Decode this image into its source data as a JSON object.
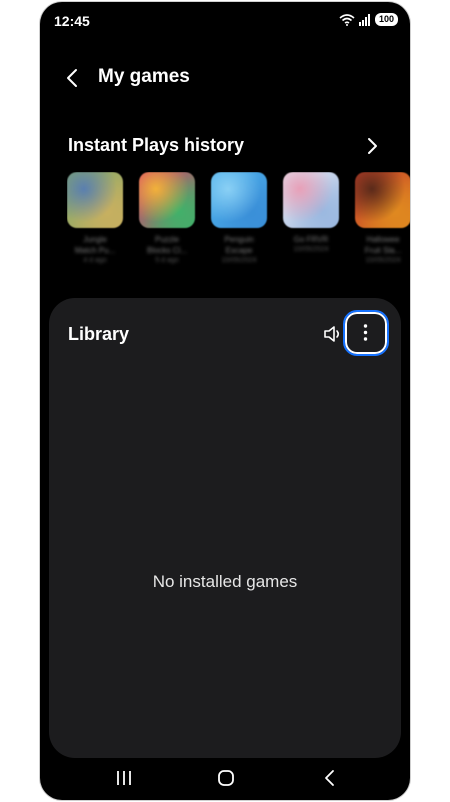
{
  "status_bar": {
    "time": "12:45",
    "battery": "100",
    "wifi_icon": "wifi-icon",
    "signal_icon": "signal-icon"
  },
  "header": {
    "title": "My games",
    "back_icon": "back-arrow-icon"
  },
  "instant_plays": {
    "title": "Instant Plays history",
    "items": [
      {
        "name": "Jungle\nMatch Pu...",
        "time": "4 d ago",
        "colors": [
          "#7fa86a",
          "#c8b060",
          "#5a7fb0"
        ]
      },
      {
        "name": "Puzzle\nBlocks Cl...",
        "time": "5 d ago",
        "colors": [
          "#e03a6e",
          "#3fb26a",
          "#f2b13a"
        ]
      },
      {
        "name": "Penguin\nEscape",
        "time": "10/05/2024",
        "colors": [
          "#4fb2ec",
          "#3a8fd8",
          "#8ad0f5"
        ]
      },
      {
        "name": "Go FRVR",
        "time": "10/05/2024",
        "colors": [
          "#e9e9f2",
          "#9ab8e0",
          "#e8a0b8"
        ]
      },
      {
        "name": "Hallowee\nFruit Sla...",
        "time": "10/05/2024",
        "colors": [
          "#c23a2a",
          "#e08a20",
          "#5a2a1a"
        ]
      }
    ]
  },
  "library": {
    "title": "Library",
    "empty_message": "No installed games"
  },
  "colors": {
    "accent": "#1672ff",
    "panel": "#1c1c1e",
    "background": "#000000"
  }
}
